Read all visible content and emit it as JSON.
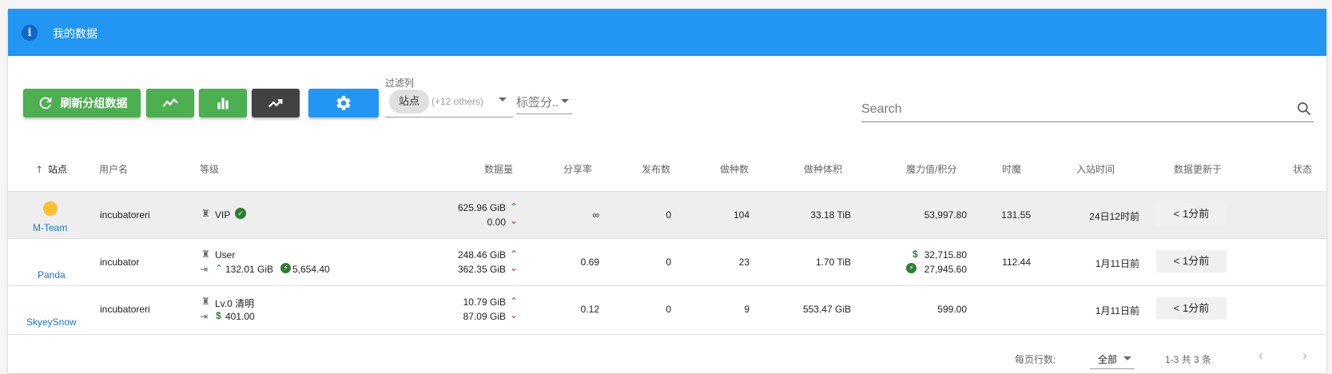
{
  "header": {
    "title": "我的数据"
  },
  "toolbar": {
    "refresh_label": "刷新分组数据",
    "filter_label": "过滤列",
    "filter_chip": "站点",
    "filter_others": "(+12 others)",
    "tag_placeholder": "标签分..",
    "search_placeholder": "Search"
  },
  "colors": {
    "header": "#2196f3",
    "green": "#4caf50",
    "dark": "#424242",
    "blue": "#2196f3"
  },
  "table": {
    "columns": [
      "站点",
      "用户名",
      "等级",
      "数据量",
      "分享率",
      "发布数",
      "做种数",
      "做种体积",
      "魔力值/积分",
      "时魔",
      "入站时间",
      "数据更新于",
      "状态"
    ],
    "rows": [
      {
        "site": "M-Team",
        "user": "incubatoreri",
        "level": "VIP",
        "level2": "",
        "level2b": "",
        "upload": "625.96 GiB",
        "download": "0.00",
        "ratio": "∞",
        "published": "0",
        "seeding": "104",
        "seed_size": "33.18 TiB",
        "bonus": "53,997.80",
        "bonus2": "",
        "hourly": "131.55",
        "join": "24日12时前",
        "updated": "< 1分前"
      },
      {
        "site": "Panda",
        "user": "incubator",
        "level": "User",
        "level2": "132.01 GiB",
        "level2b": "5,654.40",
        "upload": "248.46 GiB",
        "download": "362.35 GiB",
        "ratio": "0.69",
        "published": "0",
        "seeding": "23",
        "seed_size": "1.70 TiB",
        "bonus": "32,715.80",
        "bonus2": "27,945.60",
        "hourly": "112.44",
        "join": "1月11日前",
        "updated": "< 1分前"
      },
      {
        "site": "SkyeySnow",
        "user": "incubatoreri",
        "level": "Lv.0 清明",
        "level2": "401.00",
        "level2b": "",
        "upload": "10.79 GiB",
        "download": "87.09 GiB",
        "ratio": "0.12",
        "published": "0",
        "seeding": "9",
        "seed_size": "553.47 GiB",
        "bonus": "599.00",
        "bonus2": "",
        "hourly": "",
        "join": "1月11日前",
        "updated": "< 1分前"
      }
    ]
  },
  "footer": {
    "rows_per_page_label": "每页行数:",
    "rows_per_page_value": "全部",
    "range": "1-3 共 3 条"
  }
}
